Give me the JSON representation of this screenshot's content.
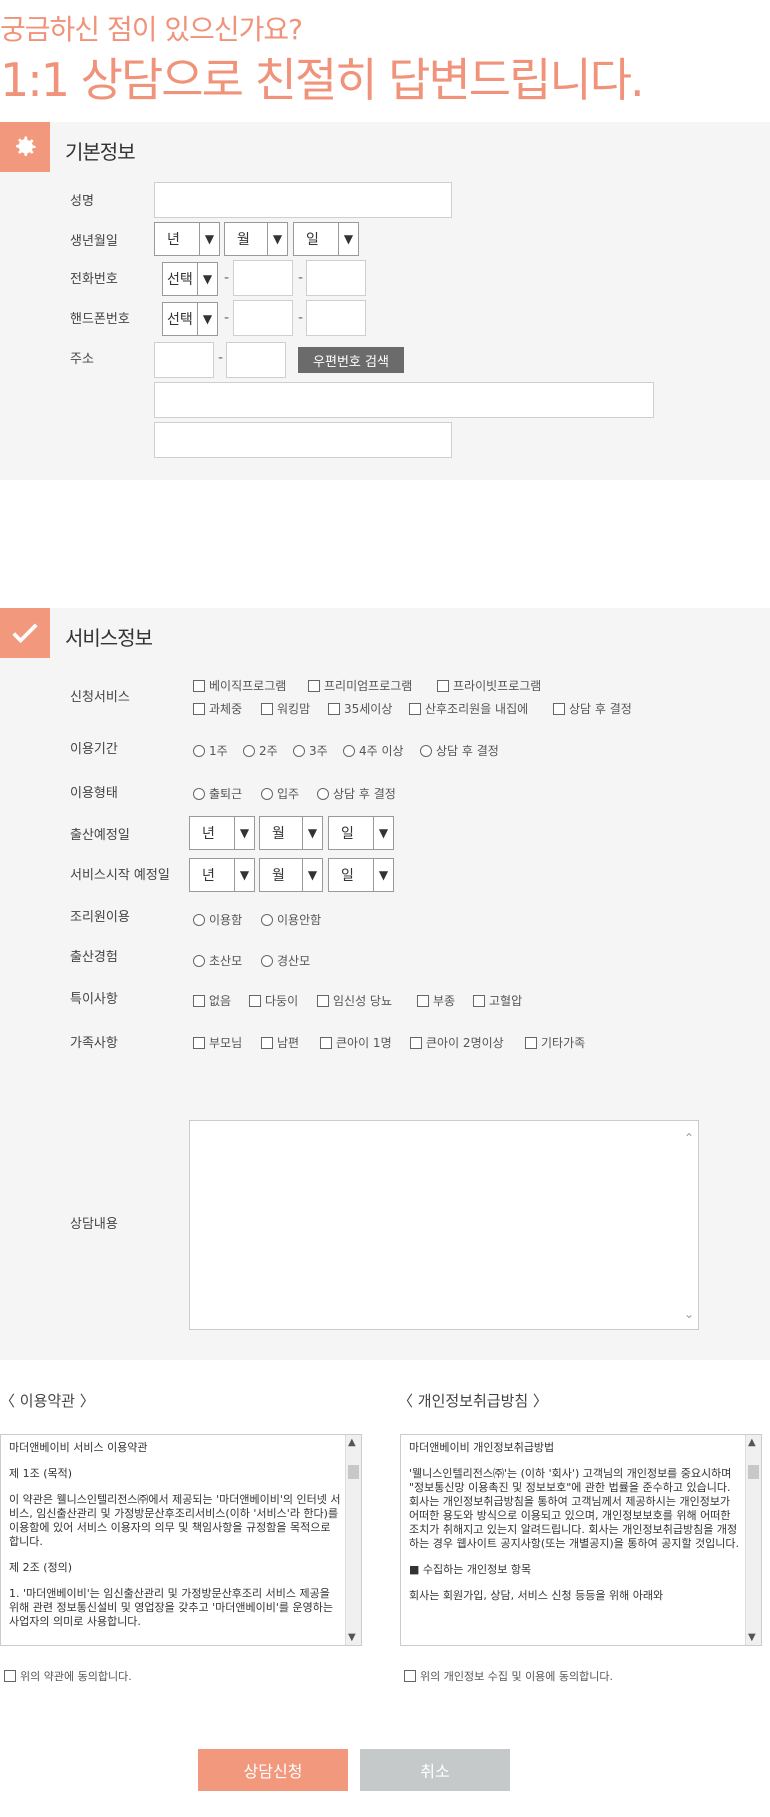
{
  "hero": {
    "subtitle": "궁금하신 점이 있으신가요?",
    "title": "1:1 상담으로 친절히 답변드립니다."
  },
  "basic": {
    "title": "기본정보",
    "icon": "gear-icon",
    "name_label": "성명",
    "birth_label": "생년월일",
    "birth_year": "년",
    "birth_month": "월",
    "birth_day": "일",
    "phone_label": "전화번호",
    "phone_select": "선택",
    "mobile_label": "핸드폰번호",
    "mobile_select": "선택",
    "address_label": "주소",
    "zip_button": "우편번호 검색",
    "dash": "-"
  },
  "service": {
    "title": "서비스정보",
    "icon": "check-icon",
    "apply_label": "신청서비스",
    "apply_row1": [
      "베이직프로그램",
      "프리미엄프로그램",
      "프라이빗프로그램"
    ],
    "apply_row2": [
      "과체중",
      "워킹맘",
      "35세이상",
      "산후조리원을 내집에",
      "상담 후 결정"
    ],
    "period_label": "이용기간",
    "period": [
      "1주",
      "2주",
      "3주",
      "4주 이상",
      "상담 후 결정"
    ],
    "type_label": "이용형태",
    "type": [
      "출퇴근",
      "입주",
      "상담 후 결정"
    ],
    "due_label": "출산예정일",
    "start_label": "서비스시작 예정일",
    "year": "년",
    "month": "월",
    "day": "일",
    "caregiver_label": "조리원이용",
    "caregiver": [
      "이용함",
      "이용안함"
    ],
    "birth_exp_label": "출산경험",
    "birth_exp": [
      "초산모",
      "경산모"
    ],
    "special_label": "특이사항",
    "special": [
      "없음",
      "다둥이",
      "임신성 당뇨",
      "부종",
      "고혈압"
    ],
    "family_label": "가족사항",
    "family": [
      "부모님",
      "남편",
      "큰아이 1명",
      "큰아이 2명이상",
      "기타가족"
    ],
    "consult_label": "상담내용"
  },
  "terms": {
    "title": "〈 이용약관 〉",
    "heading": "마더앤베이비 서비스 이용약관",
    "paragraphs": [
      "제 1조 (목적)",
      "이 약관은 웰니스인텔리전스㈜에서 제공되는 '마더앤베이비'의 인터넷 서비스, 임신출산관리 및 가정방문산후조리서비스(이하 '서비스'라 한다)를 이용함에 있어 서비스 이용자의 의무 및 책임사항을 규정함을 목적으로 합니다.",
      "제 2조 (정의)",
      "1. '마더앤베이비'는 임신출산관리 및 가정방문산후조리 서비스 제공을 위해 관련 정보통신설비 및 영업장을 갖추고 '마더앤베이비'를 운영하는 사업자의 의미로 사용합니다."
    ],
    "agree": "위의 약관에 동의합니다."
  },
  "privacy": {
    "title": "〈 개인정보취급방침 〉",
    "heading": "마더앤베이비 개인정보취급방법",
    "paragraphs": [
      "'웰니스인텔리전스㈜'는 (이하 '회사') 고객님의 개인정보를 중요시하며 \"정보통신망 이용촉진 및 정보보호\"에 관한 법률을 준수하고 있습니다. 회사는 개인정보취급방침을 통하여 고객님께서 제공하시는 개인정보가 어떠한 용도와 방식으로 이용되고 있으며, 개인정보보호를 위해 어떠한 조치가 취해지고 있는지 알려드립니다. 회사는 개인정보취급방침을 개정하는 경우 웹사이트 공지사항(또는 개별공지)을 통하여 공지할 것입니다.",
      "■ 수집하는 개인정보 항목",
      "회사는 회원가입, 상담, 서비스 신청 등등을 위해 아래와"
    ],
    "agree": "위의 개인정보 수집 및 이용에 동의합니다."
  },
  "actions": {
    "submit": "상담신청",
    "cancel": "취소"
  },
  "colors": {
    "accent": "#f2987c",
    "cancel": "#c6c9ca",
    "zip": "#6b6b6b"
  }
}
